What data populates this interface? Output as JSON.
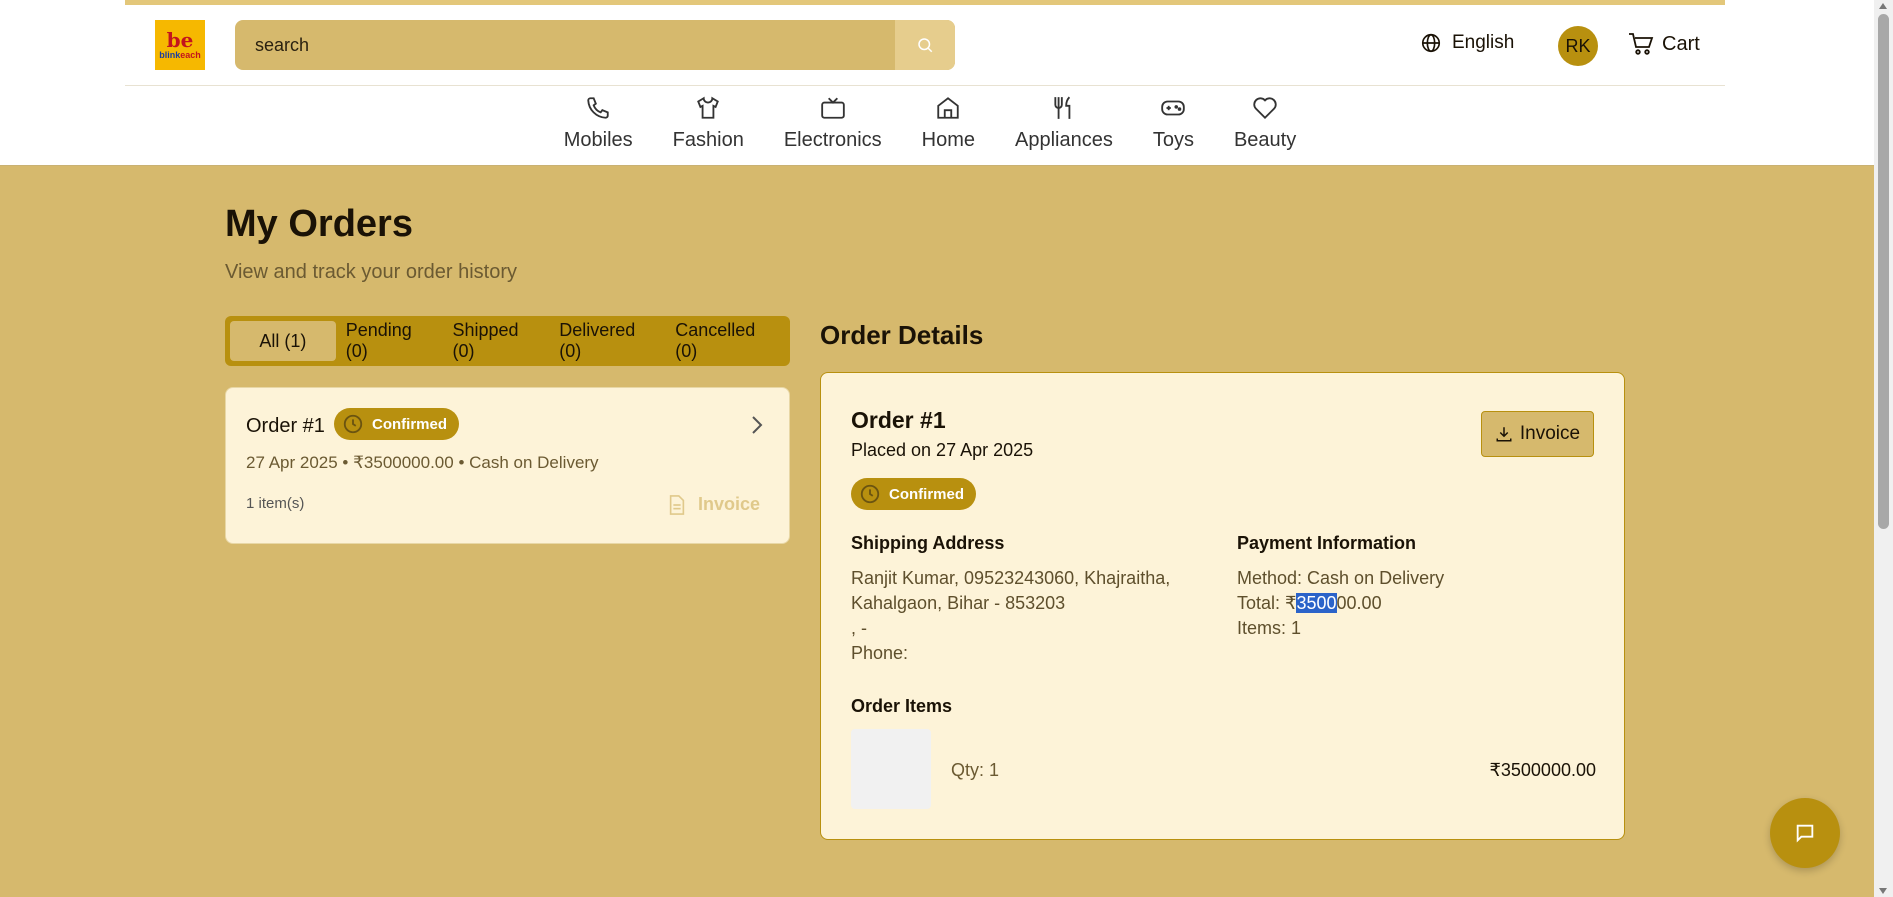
{
  "header": {
    "logo_mark": "be",
    "logo_word_a": "blink",
    "logo_word_b": "each",
    "search_placeholder": "search",
    "language": "English",
    "avatar_initials": "RK",
    "cart_label": "Cart"
  },
  "nav": [
    {
      "label": "Mobiles",
      "icon": "phone-icon"
    },
    {
      "label": "Fashion",
      "icon": "shirt-icon"
    },
    {
      "label": "Electronics",
      "icon": "tv-icon"
    },
    {
      "label": "Home",
      "icon": "home-icon"
    },
    {
      "label": "Appliances",
      "icon": "utensils-icon"
    },
    {
      "label": "Toys",
      "icon": "gamepad-icon"
    },
    {
      "label": "Beauty",
      "icon": "heart-icon"
    }
  ],
  "page": {
    "title": "My Orders",
    "subtitle": "View and track your order history"
  },
  "tabs": [
    {
      "label": "All (1)",
      "active": true
    },
    {
      "label": "Pending (0)"
    },
    {
      "label": "Shipped (0)"
    },
    {
      "label": "Delivered (0)"
    },
    {
      "label": "Cancelled (0)"
    }
  ],
  "order_card": {
    "title": "Order #1",
    "status": "Confirmed",
    "meta": "27 Apr 2025 • ₹3500000.00 • Cash on Delivery",
    "items": "1 item(s)",
    "invoice": "Invoice"
  },
  "details": {
    "heading": "Order Details",
    "order": "Order #1",
    "placed": "Placed on 27 Apr 2025",
    "status": "Confirmed",
    "invoice_button": "Invoice",
    "shipping_heading": "Shipping Address",
    "shipping_line1": "Ranjit Kumar, 09523243060, Khajraitha,",
    "shipping_line2": "Kahalgaon, Bihar - 853203",
    "shipping_line3": ", -",
    "shipping_phone": "Phone:",
    "payment_heading": "Payment Information",
    "payment_method": "Method: Cash on Delivery",
    "total_prefix": "Total: ₹",
    "total_selected": "3500",
    "total_rest": "00.00",
    "items_count": "Items: 1",
    "order_items_heading": "Order Items",
    "item_qty": "Qty: 1",
    "item_price": "₹3500000.00"
  },
  "colors": {
    "background": "#d6b96d",
    "accent": "#b8900f",
    "card": "#fdf3d8",
    "selection": "#2b63c9"
  }
}
